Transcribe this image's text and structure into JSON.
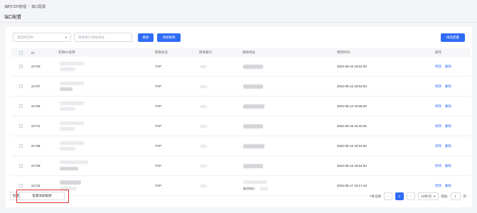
{
  "breadcrumb": {
    "parent": "海时CDN管理",
    "separator": "/",
    "current": "端口配置"
  },
  "page_title": "端口配置",
  "toolbar": {
    "instance_placeholder": "请选择实例",
    "port_placeholder": "转发端口/源站地址",
    "search_label": "搜索",
    "add_rule_label": "添加规则",
    "domain_config_label": "域名配置"
  },
  "table": {
    "headers": {
      "id": "ID",
      "name": "实例ID/名称",
      "protocol": "转发协议",
      "port": "转发端口",
      "source": "源站地址",
      "updated": "更新时间",
      "actions": "操作"
    },
    "rows": [
      {
        "id": "21740",
        "protocol": "TCP",
        "updated": "2022-05-16 16:54:20",
        "edit": "修改",
        "delete": "删除"
      },
      {
        "id": "21737",
        "protocol": "TCP",
        "updated": "2022-05-13 19:54:53",
        "edit": "修改",
        "delete": "删除"
      },
      {
        "id": "21736",
        "protocol": "TCP",
        "updated": "2022-05-13 16:56:53",
        "edit": "修改",
        "delete": "删除"
      },
      {
        "id": "21741",
        "protocol": "TCP",
        "updated": "2022-05-16 16:32:25",
        "edit": "修改",
        "delete": "删除"
      },
      {
        "id": "21738",
        "protocol": "TCP",
        "updated": "2022-05-13 19:54:53",
        "edit": "修改",
        "delete": "删除"
      },
      {
        "id": "21739",
        "protocol": "TCP",
        "updated": "2022-05-13 19:54:53",
        "edit": "修改",
        "delete": "删除"
      },
      {
        "id": "21742",
        "protocol": "TCP",
        "updated": "2022-05-17 10:17:19",
        "edit": "修改",
        "delete": "删除",
        "source_note": "备用地址："
      }
    ]
  },
  "footer": {
    "batch_delete": "批量删除",
    "batch_add": "批量添加规则",
    "total": "7条记录",
    "current_page": "1",
    "page_size": "10条/页",
    "goto_label": "前往",
    "goto_value": "1",
    "page_unit": "页",
    "prev_icon": "‹",
    "next_icon": "›",
    "size_chevron": "▾"
  },
  "colors": {
    "primary": "#2f6cf6",
    "highlight": "#e0302f"
  }
}
